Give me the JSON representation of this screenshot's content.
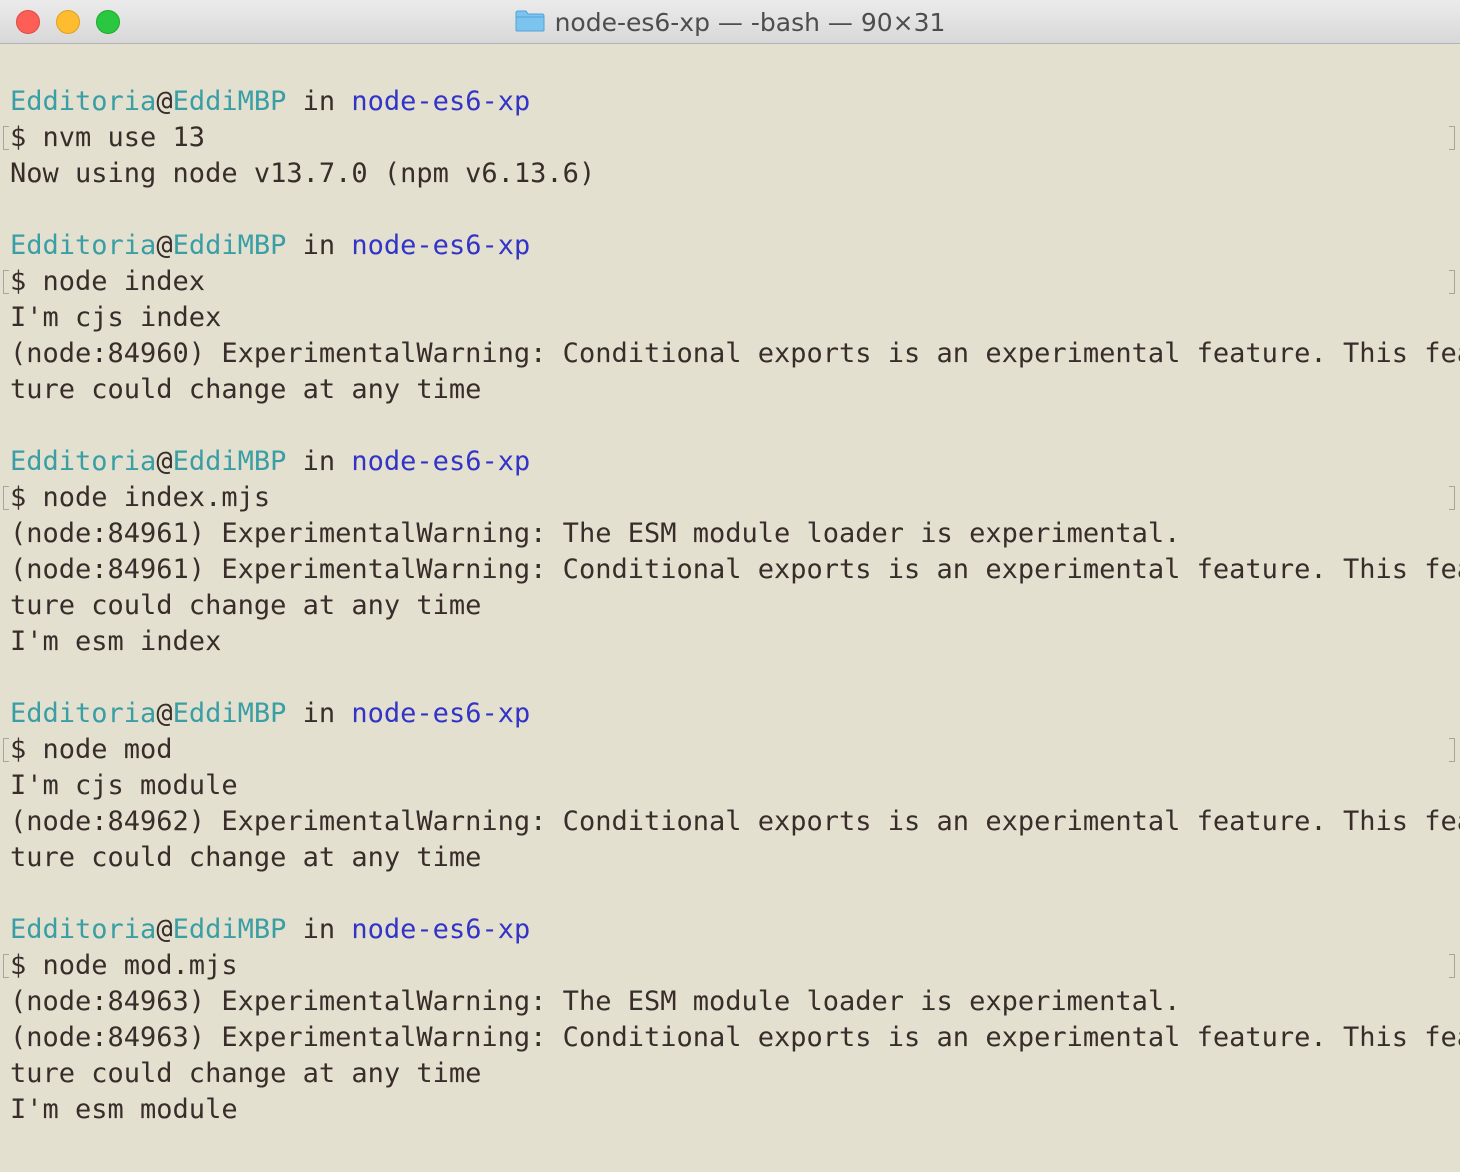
{
  "window": {
    "title": "node-es6-xp — -bash — 90×31",
    "folder_icon": "folder-icon"
  },
  "colors": {
    "background": "#e4e0cf",
    "text": "#382d2a",
    "user_host": "#3a9ea5",
    "directory": "#3234c8"
  },
  "prompt": {
    "user": "Edditoria",
    "at": "@",
    "host": "EddiMBP",
    "in": " in ",
    "dir": "node-es6-xp"
  },
  "blocks": [
    {
      "command": "$ nvm use 13",
      "output": [
        "Now using node v13.7.0 (npm v6.13.6)"
      ]
    },
    {
      "command": "$ node index",
      "output": [
        "I'm cjs index",
        "(node:84960) ExperimentalWarning: Conditional exports is an experimental feature. This fea",
        "ture could change at any time"
      ]
    },
    {
      "command": "$ node index.mjs",
      "output": [
        "(node:84961) ExperimentalWarning: The ESM module loader is experimental.",
        "(node:84961) ExperimentalWarning: Conditional exports is an experimental feature. This fea",
        "ture could change at any time",
        "I'm esm index"
      ]
    },
    {
      "command": "$ node mod",
      "output": [
        "I'm cjs module",
        "(node:84962) ExperimentalWarning: Conditional exports is an experimental feature. This fea",
        "ture could change at any time"
      ]
    },
    {
      "command": "$ node mod.mjs",
      "output": [
        "(node:84963) ExperimentalWarning: The ESM module loader is experimental.",
        "(node:84963) ExperimentalWarning: Conditional exports is an experimental feature. This fea",
        "ture could change at any time",
        "I'm esm module"
      ]
    }
  ]
}
